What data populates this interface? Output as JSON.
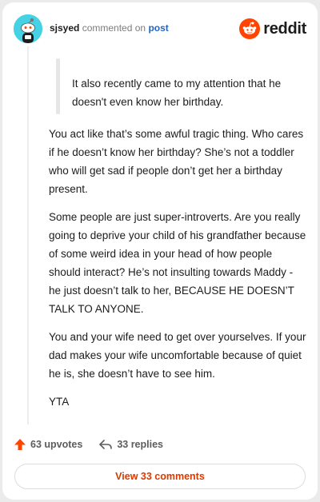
{
  "header": {
    "username": "sjsyed",
    "commented_on": "commented on",
    "post_link": "post",
    "brand": "reddit"
  },
  "comment": {
    "quote": "It also recently came to my attention that he doesn't even know her birthday.",
    "paragraphs": [
      "You act like that’s some awful tragic thing. Who cares if he doesn’t know her birthday? She’s not a toddler who will get sad if people don’t get her a birthday present.",
      "Some people are just super-introverts. Are you really going to deprive your child of his grandfather because of some weird idea in your head of how people should interact? He’s not insulting towards Maddy - he just doesn’t talk to her, BECAUSE HE DOESN’T TALK TO ANYONE.",
      "You and your wife need to get over yourselves. If your dad makes your wife uncomfortable because of quiet he is, she doesn’t have to see him.",
      "YTA"
    ]
  },
  "actions": {
    "upvotes": "63 upvotes",
    "replies": "33 replies"
  },
  "view_comments": "View 33 comments",
  "colors": {
    "brand_orange": "#ff4500",
    "upvote": "#ff4500",
    "link_blue": "#1f64c8",
    "view_text": "#d93a00",
    "avatar_bg": "#46d2e5"
  },
  "icons": {
    "avatar": "snoo-avatar-icon",
    "brand": "reddit-logo-icon",
    "upvote": "upvote-arrow-icon",
    "reply": "reply-arrow-icon"
  }
}
